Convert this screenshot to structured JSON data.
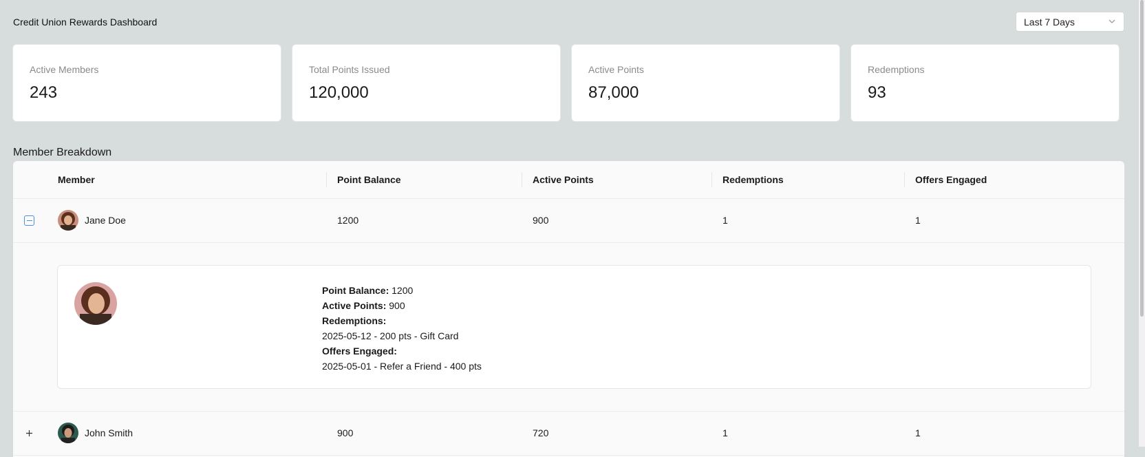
{
  "header": {
    "title": "Credit Union Rewards Dashboard",
    "range": {
      "selected": "Last 7 Days"
    }
  },
  "kpis": [
    {
      "label": "Active Members",
      "value": "243"
    },
    {
      "label": "Total Points Issued",
      "value": "120,000"
    },
    {
      "label": "Active Points",
      "value": "87,000"
    },
    {
      "label": "Redemptions",
      "value": "93"
    }
  ],
  "breakdown": {
    "title": "Member Breakdown",
    "columns": [
      "Member",
      "Point Balance",
      "Active Points",
      "Redemptions",
      "Offers Engaged"
    ],
    "rows": [
      {
        "name": "Jane Doe",
        "point_balance": "1200",
        "active_points": "900",
        "redemptions": "1",
        "offers_engaged": "1",
        "expanded": true
      },
      {
        "name": "John Smith",
        "point_balance": "900",
        "active_points": "720",
        "redemptions": "1",
        "offers_engaged": "1",
        "expanded": false
      }
    ],
    "detail": {
      "point_balance_label": "Point Balance:",
      "point_balance_value": "1200",
      "active_points_label": "Active Points:",
      "active_points_value": "900",
      "redemptions_label": "Redemptions:",
      "redemption_item": "2025-05-12 - 200 pts - Gift Card",
      "offers_label": "Offers Engaged:",
      "offer_item": "2025-05-01 - Refer a Friend - 400 pts"
    }
  },
  "icons": {
    "toggle_expanded": "minus-square-icon",
    "toggle_collapsed": "plus-icon",
    "dropdown": "chevron-down-icon"
  },
  "colors": {
    "background": "#d7dcdc",
    "accent": "#4a90e2",
    "card": "#ffffff"
  }
}
